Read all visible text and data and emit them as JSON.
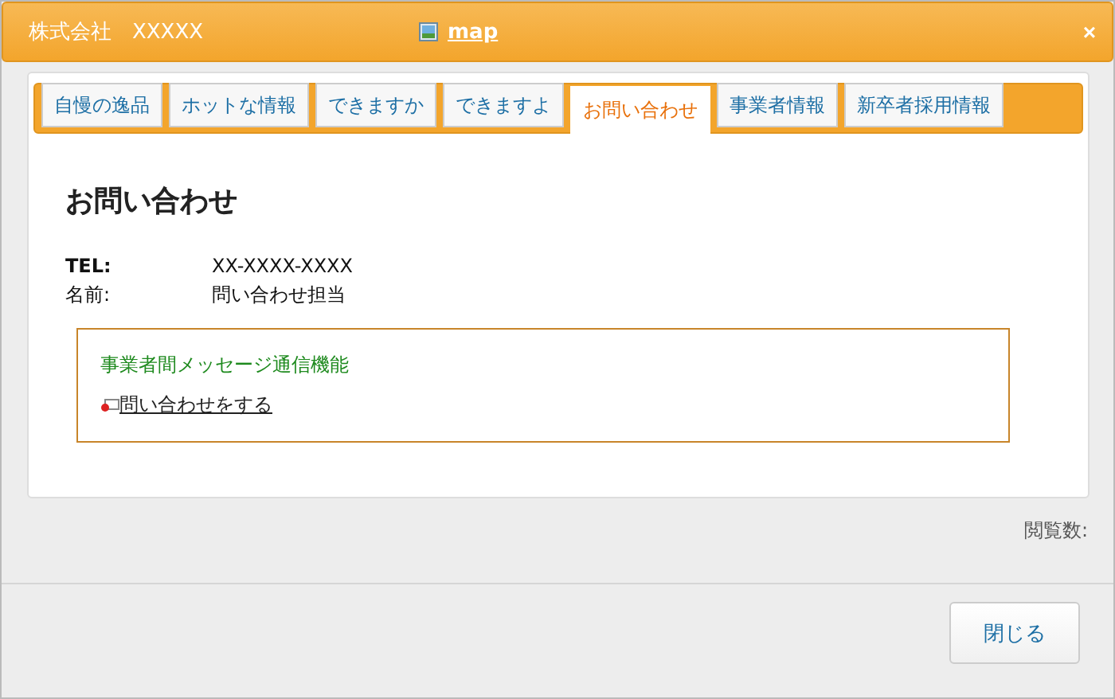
{
  "window": {
    "title": "株式会社　XXXXX",
    "map_link": "map",
    "close": "×"
  },
  "tabs": [
    {
      "label": "自慢の逸品",
      "selected": false
    },
    {
      "label": "ホットな情報",
      "selected": false
    },
    {
      "label": "できますか",
      "selected": false
    },
    {
      "label": "できますよ",
      "selected": false
    },
    {
      "label": "お問い合わせ",
      "selected": true
    },
    {
      "label": "事業者情報",
      "selected": false
    },
    {
      "label": "新卒者採用情報",
      "selected": false
    }
  ],
  "heading": "お問い合わせ",
  "details": [
    {
      "label": "TEL:",
      "value": "XX-XXXX-XXXX"
    },
    {
      "label": "名前:",
      "value": "問い合わせ担当"
    }
  ],
  "message_box": {
    "title": "事業者間メッセージ通信機能",
    "link": "問い合わせをする"
  },
  "view_count_label": "閲覧数:",
  "buttons": [
    "閉じる"
  ]
}
